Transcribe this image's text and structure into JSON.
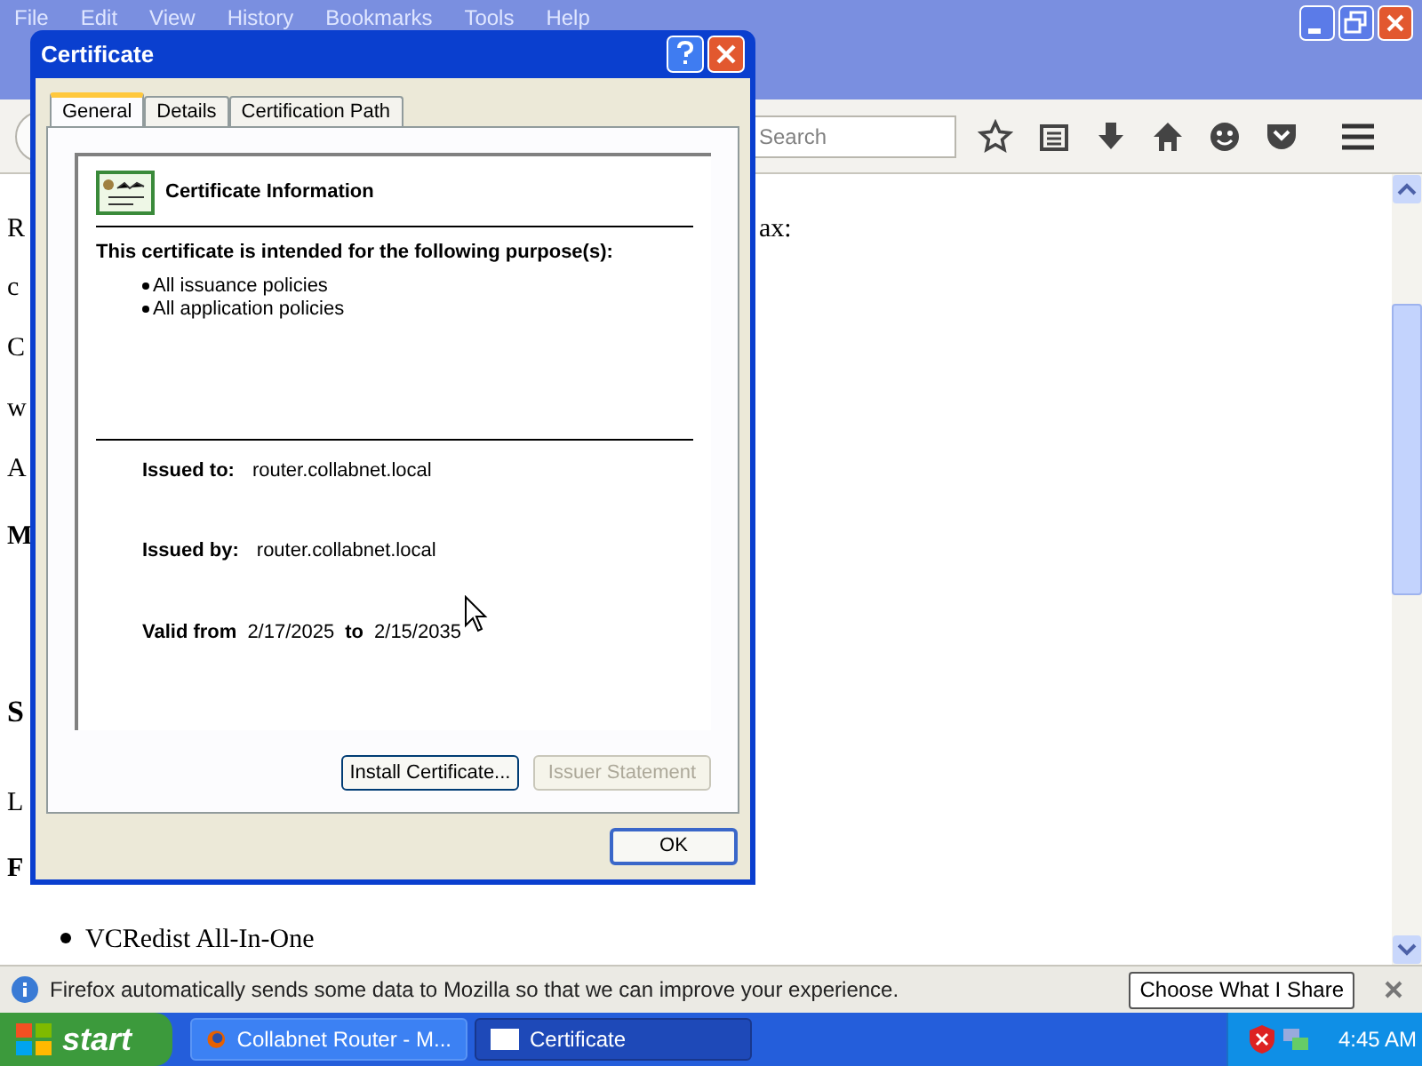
{
  "browser": {
    "menu": [
      "File",
      "Edit",
      "View",
      "History",
      "Bookmarks",
      "Tools",
      "Help"
    ],
    "search": {
      "placeholder": "Search"
    },
    "page_lines": [
      {
        "kind": "text",
        "fragments": [
          "R",
          "ax:"
        ]
      },
      {
        "kind": "text",
        "fragments": [
          "c"
        ]
      },
      {
        "kind": "text",
        "fragments": [
          "C"
        ]
      },
      {
        "kind": "text",
        "fragments": [
          "w"
        ]
      },
      {
        "kind": "text",
        "fragments": [
          "A"
        ]
      },
      {
        "kind": "heading",
        "fragments": [
          "M"
        ]
      },
      {
        "kind": "title",
        "fragments": [
          "S"
        ]
      },
      {
        "kind": "text",
        "fragments": [
          "L"
        ]
      },
      {
        "kind": "heading",
        "fragments": [
          "F"
        ]
      },
      {
        "kind": "bullet",
        "fragments": [
          "VCRedist All-In-One"
        ]
      }
    ],
    "notification": {
      "message": "Firefox automatically sends some data to Mozilla so that we can improve your experience.",
      "button": "Choose What I Share"
    }
  },
  "dialog": {
    "title": "Certificate",
    "tabs": [
      {
        "label": "General",
        "selected": true
      },
      {
        "label": "Details",
        "selected": false
      },
      {
        "label": "Certification Path",
        "selected": false
      }
    ],
    "heading": "Certificate Information",
    "purpose_title": "This certificate is intended for the following purpose(s):",
    "purposes": [
      "All issuance policies",
      "All application policies"
    ],
    "issued_to": {
      "label": "Issued to:",
      "value": "router.collabnet.local"
    },
    "issued_by": {
      "label": "Issued by:",
      "value": "router.collabnet.local"
    },
    "valid": {
      "from_label": "Valid from",
      "from": "2/17/2025",
      "to_label": "to",
      "to": "2/15/2035"
    },
    "buttons": [
      {
        "label": "Install Certificate...",
        "disabled": false
      },
      {
        "label": "Issuer Statement",
        "disabled": true
      }
    ],
    "ok": "OK"
  },
  "taskbar": {
    "start": "start",
    "tasks": [
      {
        "label": "Collabnet Router - M...",
        "kind": "browser",
        "selected": false
      },
      {
        "label": "Certificate",
        "kind": "window",
        "selected": true
      }
    ],
    "clock": "4:45 AM"
  }
}
